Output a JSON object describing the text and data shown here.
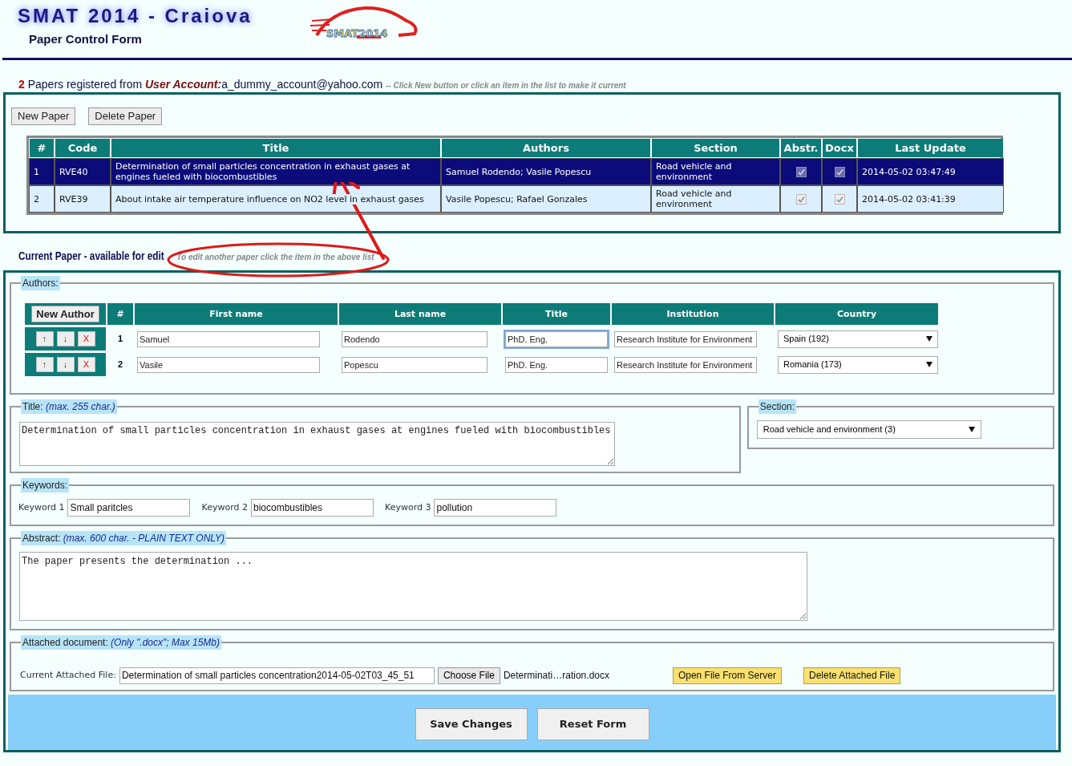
{
  "header": {
    "title": "SMAT 2014 - Craiova",
    "subtitle": "Paper Control Form",
    "logo_text": "SMAT2014"
  },
  "summary": {
    "count": "2",
    "lead": "Papers registered from",
    "account_label": "User Account:",
    "account": "a_dummy_account@yahoo.com",
    "hint": "-- Click New button or click an item in the list to make it current"
  },
  "paper_buttons": [
    "New Paper",
    "Delete Paper"
  ],
  "papers": {
    "columns": [
      "#",
      "Code",
      "Title",
      "Authors",
      "Section",
      "Abstr.",
      "Docx",
      "Last Update"
    ],
    "rows": [
      {
        "selected": true,
        "number": "1",
        "code": "RVE40",
        "title": "Determination of small particles concentration in exhaust gases at engines fueled with biocombustibles",
        "authors": "Samuel Rodendo; Vasile Popescu",
        "section": "Road vehicle and environment",
        "abstract": true,
        "docx": true,
        "last_update": "2014-05-02 03:47:49"
      },
      {
        "selected": false,
        "number": "2",
        "code": "RVE39",
        "title": "About intake air temperature influence on NO2 level in exhaust gases",
        "authors": "Vasile Popescu; Rafael Gonzales",
        "section": "Road vehicle and environment",
        "abstract": true,
        "docx": true,
        "last_update": "2014-05-02 03:41:39"
      }
    ]
  },
  "current": {
    "heading": "Current Paper - available for edit",
    "hint": "To edit another paper click the item in the above list"
  },
  "authors": {
    "legend": "Authors:",
    "new_button": "New Author",
    "columns": [
      "#",
      "First name",
      "Last name",
      "Title",
      "Institution",
      "Country"
    ],
    "rows": [
      {
        "buttons": [
          "↑",
          "↓",
          "X"
        ],
        "number": "1",
        "first_name": "Samuel",
        "last_name": "Rodendo",
        "title": "PhD. Eng.",
        "title_focused": true,
        "institution": "Research Institute for Environment",
        "country": "Spain (192)"
      },
      {
        "buttons": [
          "↑",
          "↓",
          "X"
        ],
        "number": "2",
        "first_name": "Vasile",
        "last_name": "Popescu",
        "title": "PhD. Eng.",
        "title_focused": false,
        "institution": "Research Institute for Environment",
        "country": "Romania (173)"
      }
    ]
  },
  "title_field": {
    "legend": "Title:",
    "note": "(max. 255 char.)",
    "value": "Determination of small particles concentration in exhaust gases at engines fueled with biocombustibles"
  },
  "section_field": {
    "legend": "Section:",
    "value": "Road vehicle and environment (3)"
  },
  "keywords": {
    "legend": "Keywords:",
    "items": [
      {
        "label": "Keyword 1",
        "value": "Small paritcles"
      },
      {
        "label": "Keyword 2",
        "value": "biocombustibles"
      },
      {
        "label": "Keyword 3",
        "value": "pollution"
      }
    ]
  },
  "abstract": {
    "legend": "Abstract:",
    "note": "(max. 600 char. - PLAIN TEXT ONLY)",
    "value": "The paper presents the determination ..."
  },
  "attachment": {
    "legend": "Attached document:",
    "note": "(Only \".docx\"; Max 15Mb)",
    "file_label": "Current Attached File:",
    "value": "Determination of small particles concentration2014-05-02T03_45_51",
    "choose_button": "Choose File",
    "chosen_file": "Determinati…ration.docx",
    "buttons": [
      "Open File From Server",
      "Delete Attached File"
    ]
  },
  "actions": [
    "Save Changes",
    "Reset Form"
  ]
}
